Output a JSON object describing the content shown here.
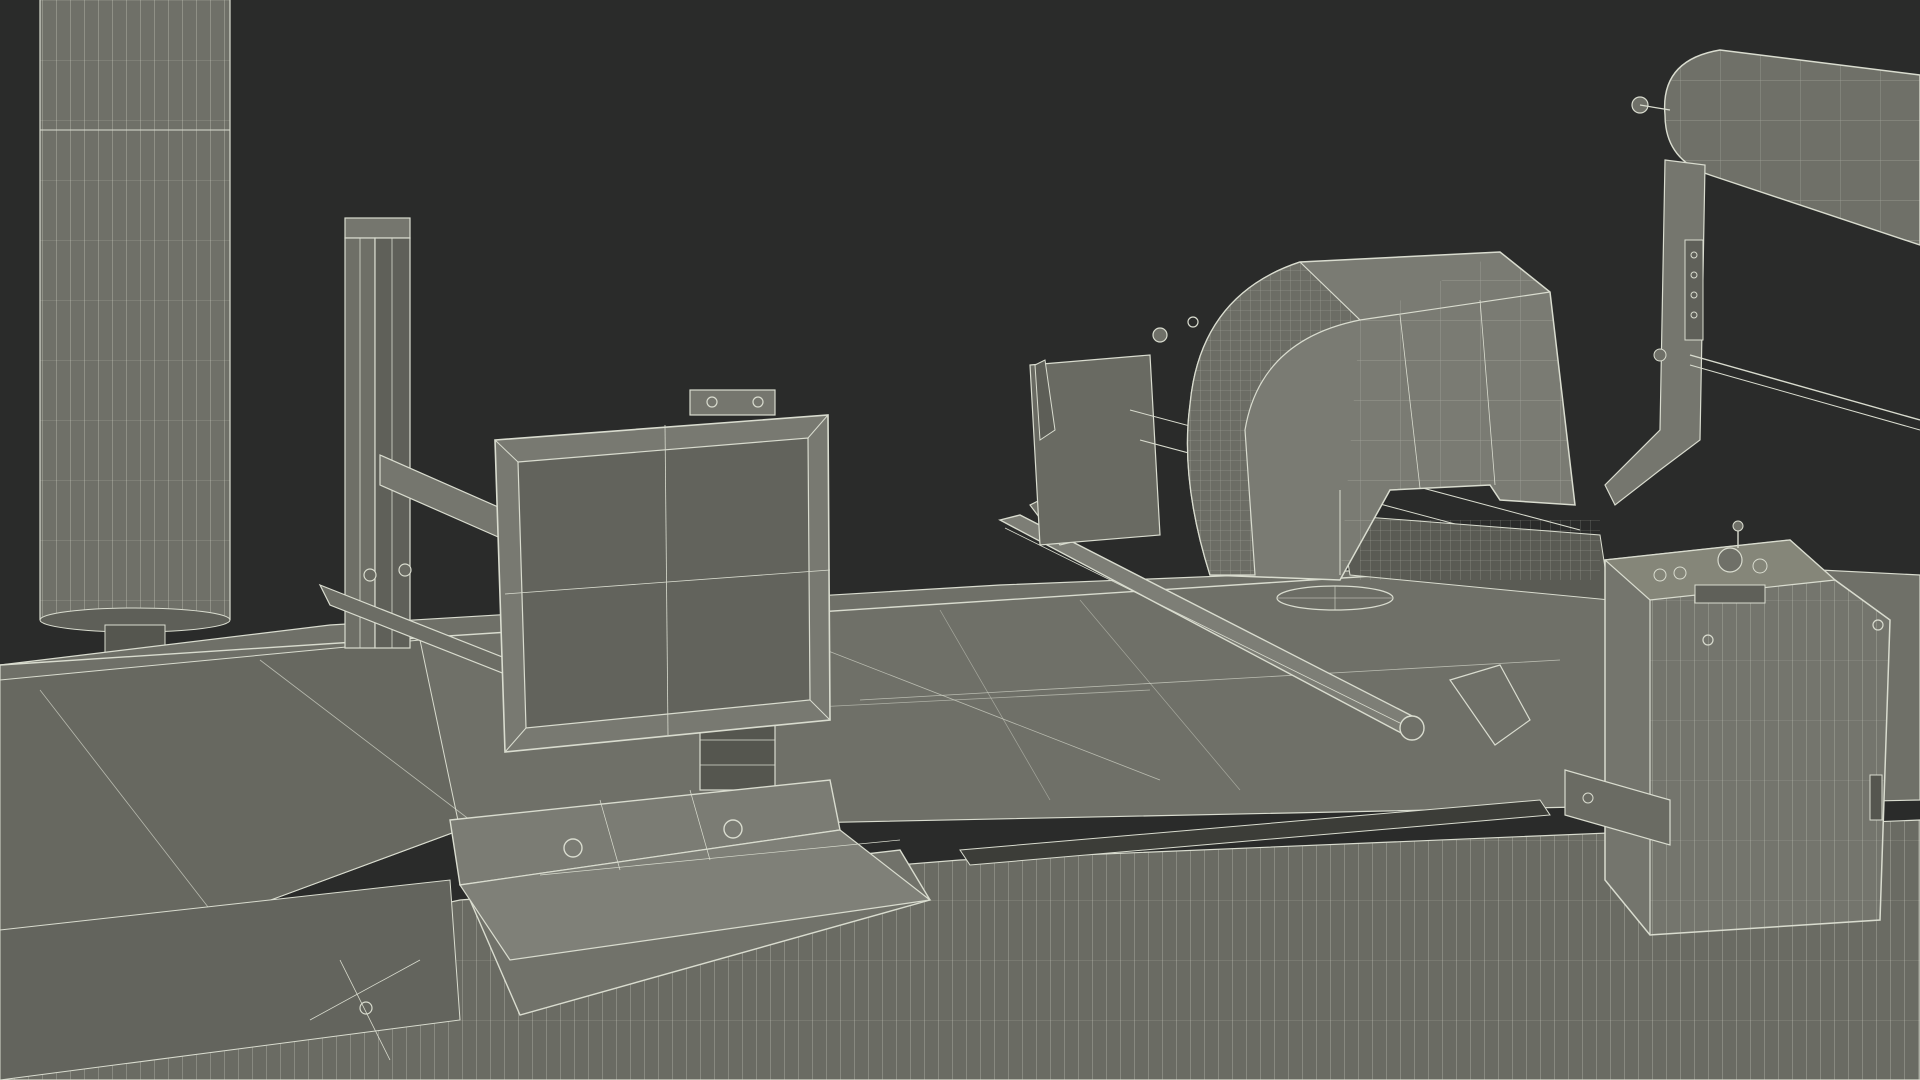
{
  "scene": {
    "background": "#2a2b2a",
    "mesh_fill": "#6f7068",
    "mesh_fill_light": "#85867d",
    "mesh_fill_dark": "#55564f",
    "wire_color": "#d9dccf",
    "render_style": "wireframe-over-shaded",
    "objects": [
      "vertical-cylinder-column",
      "cutting-table-surface",
      "monitor-stand",
      "display-panel",
      "cutting-head-housing",
      "gantry-bar",
      "control-box",
      "material-roll",
      "front-keyboard-shelf",
      "table-front-apron"
    ]
  }
}
